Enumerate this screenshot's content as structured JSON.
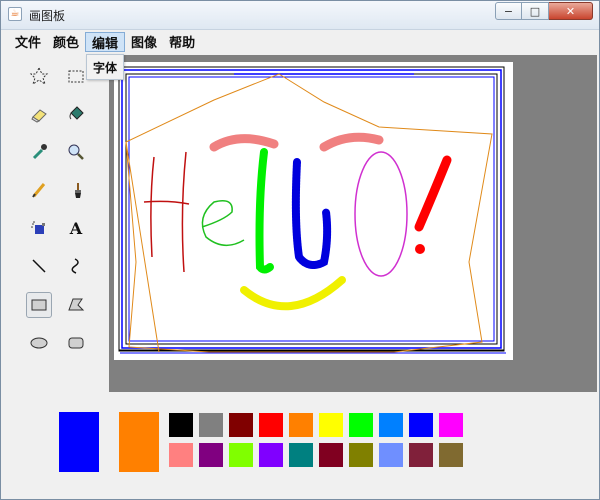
{
  "window": {
    "title": "画图板"
  },
  "window_controls": {
    "minimize": "−",
    "maximize": "□",
    "close": "✕"
  },
  "menu": {
    "items": [
      "文件",
      "颜色",
      "编辑",
      "图像",
      "帮助"
    ],
    "active_index": 2,
    "dropdown_item": "字体"
  },
  "tools": [
    "free-select-icon",
    "rect-select-icon",
    "eraser-icon",
    "fill-bucket-icon",
    "color-picker-icon",
    "magnifier-icon",
    "pencil-icon",
    "brush-icon",
    "airbrush-icon",
    "text-icon",
    "line-icon",
    "curve-icon",
    "rectangle-icon",
    "polygon-icon",
    "ellipse-icon",
    "rounded-rect-icon"
  ],
  "text_tool_glyph": "A",
  "selected_tool": "rectangle-icon",
  "colors": {
    "foreground": "#0000ff",
    "background": "#ff8000",
    "palette_row1": [
      "#000000",
      "#808080",
      "#800000",
      "#ff0000",
      "#ff8000",
      "#ffff00",
      "#00ff00",
      "#0080ff",
      "#0000ff",
      "#ff00ff"
    ],
    "palette_row2": [
      "#ff8080",
      "#800080",
      "#80ff00",
      "#8000ff",
      "#008080",
      "#800020",
      "#808000",
      "#6f8fff",
      "#80203a",
      "#806a30"
    ]
  }
}
